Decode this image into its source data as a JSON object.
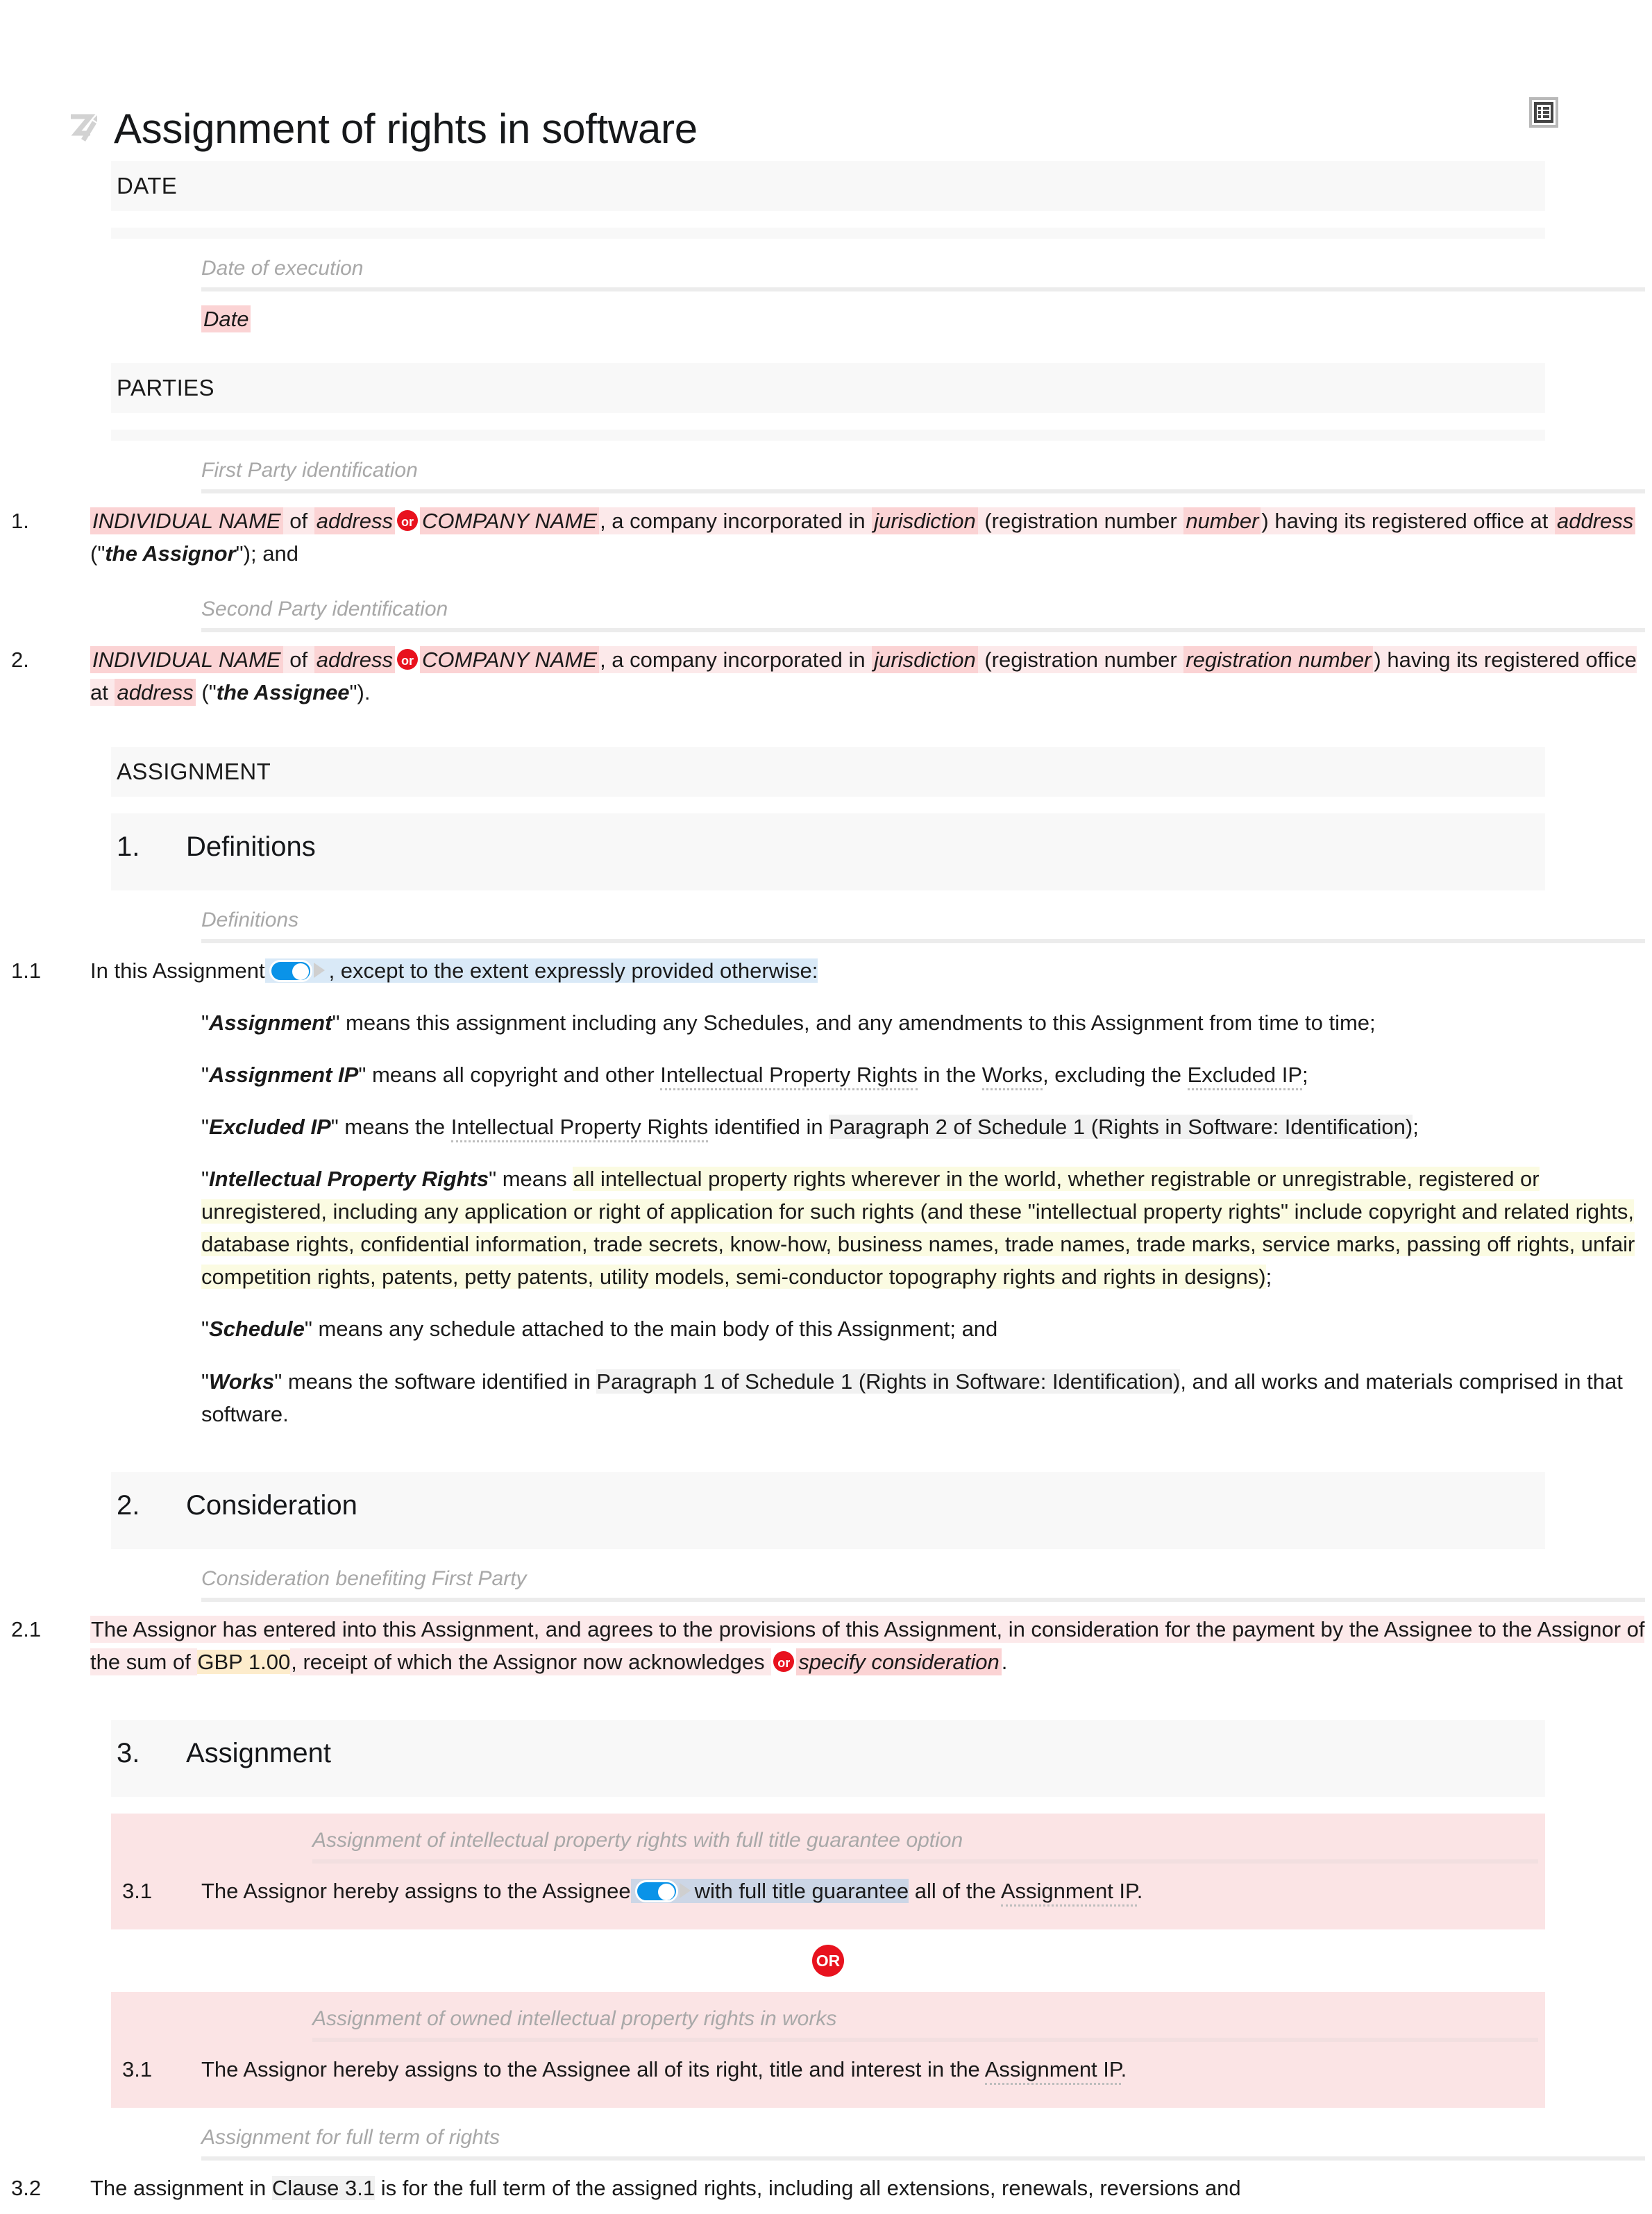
{
  "document": {
    "title": "Assignment of rights in software",
    "logo_icon": "zegal-3-logo",
    "header_tool_icon": "document-list-icon"
  },
  "sections": {
    "date": {
      "heading": "DATE",
      "guide": "Date of execution",
      "value": "Date"
    },
    "parties": {
      "heading": "PARTIES",
      "first": {
        "guide": "First Party identification",
        "num": "1.",
        "t1": "INDIVIDUAL NAME",
        "t2": " of ",
        "t3": "address",
        "or": "or",
        "t4": "COMPANY NAME",
        "t5": ", a company incorporated in ",
        "t6": "jurisdiction",
        "t7": " (registration number ",
        "t8": "number",
        "t9": ") having its registered office at ",
        "t10": "address",
        "t11": " (\"",
        "t12": "the Assignor",
        "t13": "\"); and"
      },
      "second": {
        "guide": "Second Party identification",
        "num": "2.",
        "t1": "INDIVIDUAL NAME",
        "t2": " of ",
        "t3": "address",
        "or": "or",
        "t4": "COMPANY NAME",
        "t5": ", a company incorporated in ",
        "t6": "jurisdiction",
        "t7": " (registration number ",
        "t8": "registration number",
        "t9": ") having its registered office at ",
        "t10": "address",
        "t11": " (\"",
        "t12": "the Assignee",
        "t13": "\")."
      }
    },
    "assignment_heading": "ASSIGNMENT",
    "clause1": {
      "num": "1.",
      "title": "Definitions",
      "guide": "Definitions",
      "p11": {
        "num": "1.1",
        "lead": "In this Assignment",
        "toggle_state": "on",
        "rest": ", except to the extent expressly provided otherwise:"
      },
      "definitions": [
        {
          "term": "Assignment",
          "rest": "\" means this assignment including any Schedules, and any amendments to this Assignment from time to time;"
        },
        {
          "term": "Assignment IP",
          "rest": "\" means all copyright and other Intellectual Property Rights in the Works, excluding the Excluded IP;"
        },
        {
          "term": "Excluded IP",
          "rest": "\" means the Intellectual Property Rights identified in Paragraph 2 of Schedule 1 (Rights in Software: Identification);"
        },
        {
          "term": "Intellectual Property Rights",
          "rest": "\" means all intellectual property rights wherever in the world, whether registrable or unregistrable, registered or unregistered, including any application or right of application for such rights (and these \"intellectual property rights\" include copyright and related rights, database rights, confidential information, trade secrets, know-how, business names, trade names, trade marks, service marks, passing off rights, unfair competition rights, patents, petty patents, utility models, semi-conductor topography rights and rights in designs);"
        },
        {
          "term": "Schedule",
          "rest": "\" means any schedule attached to the main body of this Assignment; and"
        },
        {
          "term": "Works",
          "rest": "\" means the software identified in Paragraph 1 of Schedule 1 (Rights in Software: Identification), and all works and materials comprised in that software."
        }
      ],
      "def2_parts": {
        "a": "\" means all copyright and other ",
        "b": "Intellectual Property Rights",
        "c": " in the ",
        "d": "Works",
        "e": ", excluding the ",
        "f": "Excluded IP",
        "g": ";"
      },
      "def3_parts": {
        "a": "\" means the ",
        "b": "Intellectual Property Rights",
        "c": " identified in ",
        "d": "Paragraph 2 of Schedule 1 (Rights in Software: Identification)",
        "e": ";"
      },
      "def4_parts": {
        "a": "\" means ",
        "b": "all intellectual property rights wherever in the world, whether registrable or unregistrable, registered or unregistered, including any application or right of application for such rights (and these \"intellectual property rights\" include copyright and related rights, database rights, confidential information, trade secrets, know-how, business names, trade names, trade marks, service marks, passing off rights, unfair competition rights, patents, petty patents, utility models, semi-conductor topography rights and rights in designs)",
        "c": ";"
      },
      "def6_parts": {
        "a": "\" means the software identified in ",
        "b": "Paragraph 1 of Schedule 1 (Rights in Software: Identification)",
        "c": ", and all works and materials comprised in that software."
      }
    },
    "clause2": {
      "num": "2.",
      "title": "Consideration",
      "guide": "Consideration benefiting First Party",
      "p21": {
        "num": "2.1",
        "a": "The Assignor has entered into this Assignment, and agrees to the provisions of this Assignment, in consideration for the payment by the Assignee to the Assignor of the sum of ",
        "amount": "GBP 1.00",
        "b": ", receipt of which the Assignor now acknowledges ",
        "or": "or",
        "c": "specify consideration",
        "d": "."
      }
    },
    "clause3": {
      "num": "3.",
      "title": "Assignment",
      "option_a": {
        "guide": "Assignment of intellectual property rights with full title guarantee option",
        "num": "3.1",
        "a": "The Assignor hereby assigns to the Assignee",
        "toggle_state": "on",
        "b": "with full title guarantee",
        "c": " all of the ",
        "d": "Assignment IP",
        "e": "."
      },
      "or_divider": "OR",
      "option_b": {
        "guide": "Assignment of owned intellectual property rights in works",
        "num": "3.1",
        "a": "The Assignor hereby assigns to the Assignee all of its right, title and interest in the ",
        "b": "Assignment IP",
        "c": "."
      },
      "p32": {
        "guide": "Assignment for full term of rights",
        "num": "3.2",
        "a": "The assignment in ",
        "b": "Clause 3.1",
        "c": " is for the full term of the assigned rights, including all extensions, renewals, reversions and"
      }
    }
  },
  "colors": {
    "placeholder": "#fbd3d4",
    "placeholder_soft": "#fce9ea",
    "or_badge": "#e8121e",
    "toggle_on": "#0a93e8",
    "highlight_yellow": "#fbfbe2",
    "highlight_amber": "#fdeccc",
    "highlight_blue": "#d9e9f7",
    "band_shade": "#f8f8f8",
    "band_pink": "#fbe4e5"
  }
}
